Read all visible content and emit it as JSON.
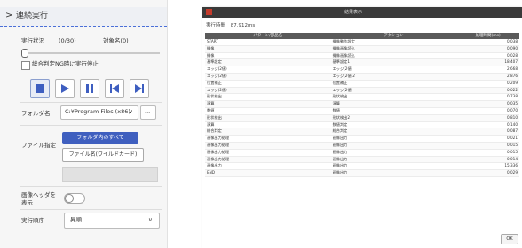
{
  "left_panel": {
    "header_title": "連続実行",
    "status_label": "実行状況",
    "progress_count": "(0/30)",
    "target_label": "対象名(0)",
    "progress_fraction": 0,
    "checkbox_label": "総合判定NG時に実行停止",
    "checkbox_checked": false,
    "folder_label": "フォルダ名",
    "folder_value": "C:¥Program Files (x86)",
    "browse_label": "...",
    "file_spec_label": "ファイル指定",
    "all_files_button": "フォルダ内のすべて",
    "wildcard_button": "ファイル名(ワイルドカード)",
    "image_save_label": "画像ヘッダを表示",
    "image_save_on": false,
    "exec_order_label": "実行順序",
    "exec_order_value": "昇順"
  },
  "result_window": {
    "title": "結果表示",
    "summary_label": "実行時間",
    "summary_value": "87.912ms",
    "columns": [
      "パターン/部品名",
      "アクション",
      "処理時間(ms)"
    ],
    "rows": [
      [
        "START",
        "撮像動作設定",
        "0.038"
      ],
      [
        "撮像",
        "撮像画像読込",
        "0.090"
      ],
      [
        "撮像",
        "撮像画像読込",
        "0.028"
      ],
      [
        "基準設定",
        "基準設定1",
        "18.407"
      ],
      [
        "エッジ(2値)",
        "エッジ(2値)",
        "2.668"
      ],
      [
        "エッジ(2値)",
        "エッジ(2値)2",
        "2.876"
      ],
      [
        "位置補正",
        "位置補正",
        "0.209"
      ],
      [
        "エッジ(2値)",
        "エッジ(2値)",
        "0.022"
      ],
      [
        "形状検出",
        "形状検出",
        "0.738"
      ],
      [
        "演算",
        "演算",
        "0.035"
      ],
      [
        "数値",
        "数値",
        "0.070"
      ],
      [
        "形状検出",
        "形状検出2",
        "0.810"
      ],
      [
        "演算",
        "数値判定",
        "0.140"
      ],
      [
        "総合判定",
        "総合判定",
        "0.087"
      ],
      [
        "画像出力処理",
        "画像出力",
        "0.021"
      ],
      [
        "画像出力処理",
        "画像出力",
        "0.015"
      ],
      [
        "画像出力処理",
        "画像出力",
        "0.015"
      ],
      [
        "画像出力処理",
        "画像出力",
        "0.014"
      ],
      [
        "画像出力",
        "画像出力",
        "15.336"
      ],
      [
        "END",
        "画像出力",
        "0.029"
      ]
    ],
    "ok_label": "OK"
  }
}
